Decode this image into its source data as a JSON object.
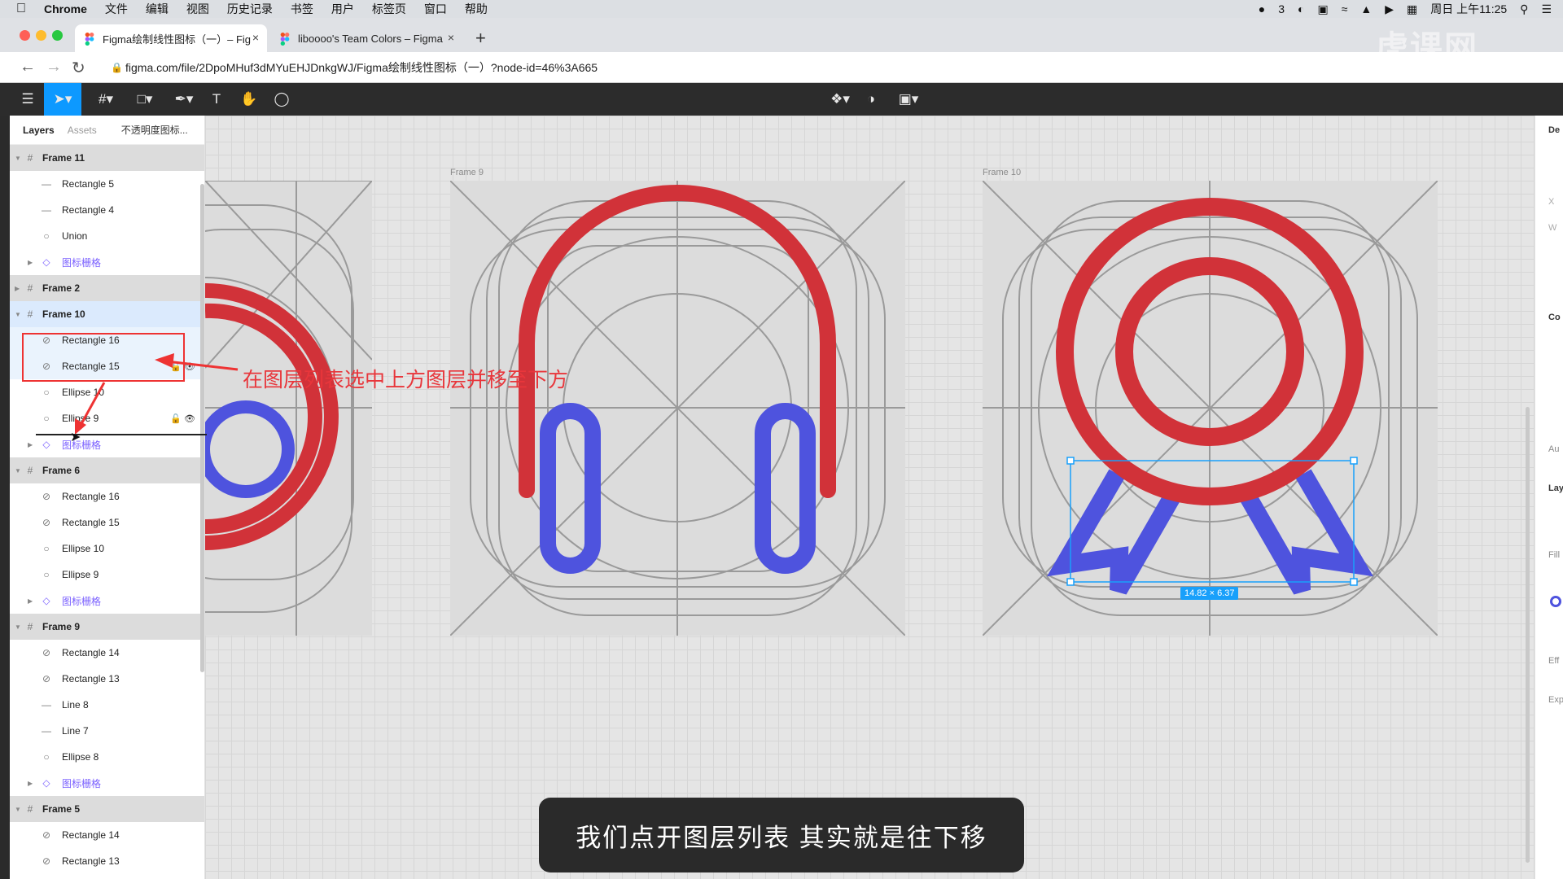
{
  "menubar": {
    "app": "Chrome",
    "items": [
      "文件",
      "编辑",
      "视图",
      "历史记录",
      "书签",
      "用户",
      "标签页",
      "窗口",
      "帮助"
    ],
    "status_count": "3",
    "clock": "周日 上午11:25"
  },
  "browser": {
    "tabs": [
      {
        "title": "Figma绘制线性图标（一）– Fig",
        "close": "×"
      },
      {
        "title": "liboooo's Team Colors – Figma",
        "close": "×"
      }
    ],
    "new_tab": "+",
    "url": "figma.com/file/2DpoMHuf3dMYuEHJDnkgWJ/Figma绘制线性图标（一）?node-id=46%3A665"
  },
  "layers_panel": {
    "tab_layers": "Layers",
    "tab_assets": "Assets",
    "page_name": "不透明度图标...",
    "rows": [
      {
        "name": "Frame 11",
        "kind": "frame"
      },
      {
        "name": "Rectangle 5",
        "kind": "line"
      },
      {
        "name": "Rectangle 4",
        "kind": "line"
      },
      {
        "name": "Union",
        "kind": "union"
      },
      {
        "name": "图标栅格",
        "kind": "component"
      },
      {
        "name": "Frame 2",
        "kind": "frame"
      },
      {
        "name": "Frame 10",
        "kind": "frame"
      },
      {
        "name": "Rectangle 16",
        "kind": "rect"
      },
      {
        "name": "Rectangle 15",
        "kind": "rect"
      },
      {
        "name": "Ellipse 10",
        "kind": "ellipse"
      },
      {
        "name": "Ellipse 9",
        "kind": "ellipse"
      },
      {
        "name": "图标栅格",
        "kind": "component"
      },
      {
        "name": "Frame 6",
        "kind": "frame"
      },
      {
        "name": "Rectangle 16",
        "kind": "rect"
      },
      {
        "name": "Rectangle 15",
        "kind": "rect"
      },
      {
        "name": "Ellipse 10",
        "kind": "ellipse"
      },
      {
        "name": "Ellipse 9",
        "kind": "ellipse"
      },
      {
        "name": "图标栅格",
        "kind": "component"
      },
      {
        "name": "Frame 9",
        "kind": "frame"
      },
      {
        "name": "Rectangle 14",
        "kind": "rect"
      },
      {
        "name": "Rectangle 13",
        "kind": "rect"
      },
      {
        "name": "Line 8",
        "kind": "line"
      },
      {
        "name": "Line 7",
        "kind": "line"
      },
      {
        "name": "Ellipse 8",
        "kind": "ellipse"
      },
      {
        "name": "图标栅格",
        "kind": "component"
      },
      {
        "name": "Frame 5",
        "kind": "frame"
      },
      {
        "name": "Rectangle 14",
        "kind": "rect"
      },
      {
        "name": "Rectangle 13",
        "kind": "rect"
      }
    ]
  },
  "canvas": {
    "frame_labels": [
      "Frame 9",
      "Frame 10"
    ],
    "selection_size": "14.82 × 6.37",
    "colors": {
      "stroke_red": "#d13239",
      "stroke_blue": "#4e53de",
      "grid_line": "#9a9a9a",
      "selection": "#18a0fb"
    }
  },
  "right_panel": {
    "labels": [
      "De",
      "X",
      "W",
      "Co",
      "Au",
      "Lay",
      "Fill",
      "Eff",
      "Exp"
    ]
  },
  "annotation": {
    "text": "在图层列表选中上方图层并移至下方"
  },
  "subtitle": "我们点开图层列表  其实就是往下移",
  "watermark": "虎课网"
}
